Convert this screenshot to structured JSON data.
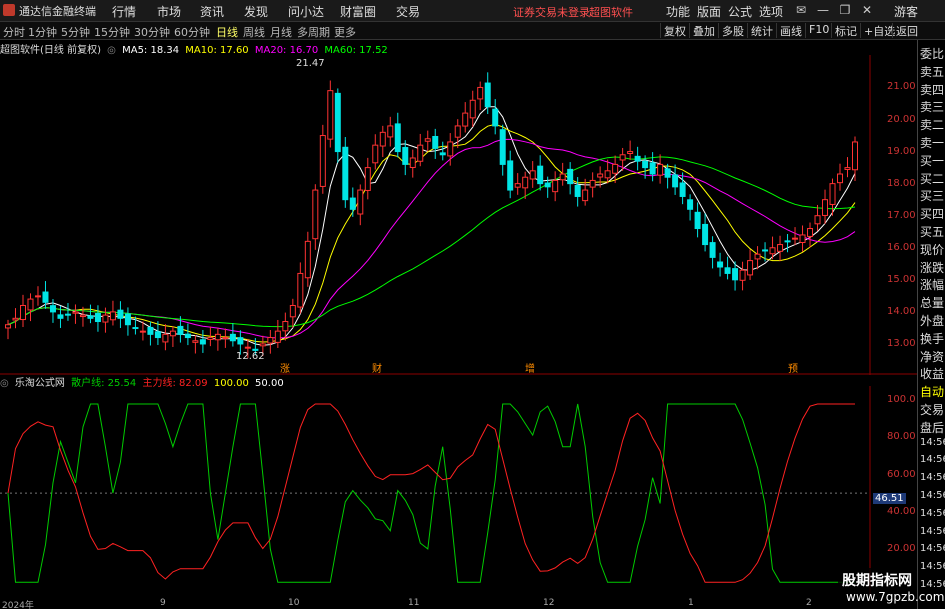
{
  "menubar": {
    "app_name": "通达信金融终端",
    "menus": [
      "行情",
      "市场",
      "资讯",
      "发现",
      "问小达",
      "财富圈",
      "交易"
    ],
    "alert": "证券交易未登录",
    "software": "超图软件",
    "right_menus": [
      "功能",
      "版面",
      "公式",
      "选项"
    ],
    "guest": "游客"
  },
  "toolbar": {
    "periods": [
      "分时",
      "1分钟",
      "5分钟",
      "15分钟",
      "30分钟",
      "60分钟",
      "日线",
      "周线",
      "月线",
      "多周期",
      "更多"
    ],
    "active_period": "日线",
    "tools": [
      "复权",
      "叠加",
      "多股",
      "统计",
      "画线",
      "F10",
      "标记",
      "+自选",
      "返回"
    ]
  },
  "info_bar": {
    "title": "超图软件(日线 前复权)",
    "ma5": "MA5: 18.34",
    "ma10": "MA10: 17.60",
    "ma20": "MA20: 16.70",
    "ma60": "MA60: 17.52"
  },
  "price_axis": [
    "21.00",
    "20.00",
    "19.00",
    "18.00",
    "17.00",
    "16.00",
    "15.00",
    "14.00",
    "13.00"
  ],
  "annotations": {
    "high": "21.47",
    "low": "12.62",
    "event_labels": [
      "涨",
      "财",
      "增",
      "预"
    ]
  },
  "lower_info": {
    "formula": "乐淘公式网",
    "retail_line": "散户线: 25.54",
    "main_line": "主力线: 82.09",
    "ref100": "100.00",
    "ref50": "50.00",
    "ref0": "50.00"
  },
  "lower_axis": [
    "100.0",
    "80.00",
    "60.00",
    "40.00",
    "20.00"
  ],
  "lower_axis_highlight": "46.51",
  "side_panel": {
    "labels": [
      "委比",
      "卖五",
      "卖四",
      "卖三",
      "卖二",
      "卖一",
      "买一",
      "买二",
      "买三",
      "买四",
      "买五",
      "现价",
      "涨跌",
      "涨幅",
      "总量",
      "外盘",
      "换手",
      "净资",
      "收益",
      "自动",
      "交易",
      "盘后",
      "14:56",
      "14:56",
      "14:56",
      "14:56",
      "14:56",
      "14:56",
      "14:56",
      "14:56",
      "14:56"
    ]
  },
  "date_axis": [
    "2024年",
    "9",
    "10",
    "11",
    "12",
    "1",
    "2"
  ],
  "watermark": {
    "title": "股期指标网",
    "url": "www.7gpzb.com"
  },
  "colors": {
    "up": "#ff3333",
    "down": "#00e5e5",
    "ma5": "#ffffff",
    "ma10": "#ffff00",
    "ma20": "#ff00ff",
    "ma60": "#00ff00",
    "retail": "#00cc00",
    "main": "#ff2222"
  },
  "chart_data": {
    "type": "candlestick",
    "price_range": [
      12.5,
      21.7
    ],
    "closes": [
      13.6,
      13.8,
      14.2,
      14.4,
      14.5,
      14.3,
      14.0,
      13.8,
      13.9,
      14.0,
      13.9,
      13.8,
      13.7,
      13.9,
      14.0,
      13.8,
      13.6,
      13.5,
      13.4,
      13.3,
      13.2,
      13.3,
      13.4,
      13.3,
      13.2,
      13.1,
      13.0,
      13.2,
      13.3,
      13.2,
      13.1,
      13.0,
      12.9,
      12.8,
      13.0,
      13.2,
      13.4,
      13.7,
      14.2,
      15.2,
      16.2,
      17.8,
      19.5,
      20.9,
      19.0,
      17.5,
      17.2,
      17.8,
      18.5,
      19.2,
      19.6,
      19.8,
      19.0,
      18.6,
      18.8,
      19.2,
      19.4,
      19.1,
      18.9,
      19.3,
      19.8,
      20.2,
      20.6,
      21.0,
      20.4,
      19.8,
      18.6,
      17.8,
      18.0,
      18.2,
      18.4,
      18.0,
      17.9,
      18.1,
      18.3,
      18.0,
      17.6,
      17.8,
      18.1,
      18.3,
      18.4,
      18.6,
      18.9,
      19.0,
      18.7,
      18.5,
      18.3,
      18.6,
      18.2,
      17.9,
      17.6,
      17.2,
      16.6,
      16.1,
      15.7,
      15.4,
      15.2,
      15.0,
      15.3,
      15.6,
      15.8,
      15.9,
      16.0,
      16.1,
      16.2,
      16.3,
      16.4,
      16.6,
      17.0,
      17.5,
      18.0,
      18.3,
      18.5,
      19.3
    ]
  }
}
